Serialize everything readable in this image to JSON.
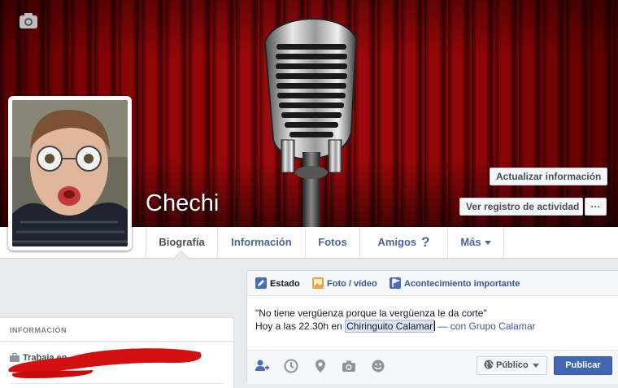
{
  "profile": {
    "name": "Chechi"
  },
  "cover": {
    "camera_icon": "camera-icon",
    "update_info_label": "Actualizar información",
    "activity_log_label": "Ver registro de actividad",
    "more_label": "···"
  },
  "nav": {
    "tabs": [
      {
        "label": "Biografía"
      },
      {
        "label": "Información"
      },
      {
        "label": "Fotos"
      },
      {
        "label": "Amigos",
        "badge": "?"
      },
      {
        "label": "Más"
      }
    ]
  },
  "info": {
    "heading": "INFORMACIÓN",
    "work_label": "Trabaja en"
  },
  "composer": {
    "tabs": {
      "estado": "Estado",
      "foto": "Foto / vídeo",
      "acontecimiento": "Acontecimiento importante"
    },
    "quote": "\"No tiene vergüenza porque la vergüenza le da corte\"",
    "line2_prefix": "Hoy a las 22.30h en ",
    "place": "Chiringuito Calamar",
    "with_text": " — con Grupo Calamar",
    "privacy_label": "Público",
    "publish_label": "Publicar"
  },
  "colors": {
    "accent": "#4267b2",
    "link": "#3b5998",
    "curtain": "#a30a0c"
  }
}
